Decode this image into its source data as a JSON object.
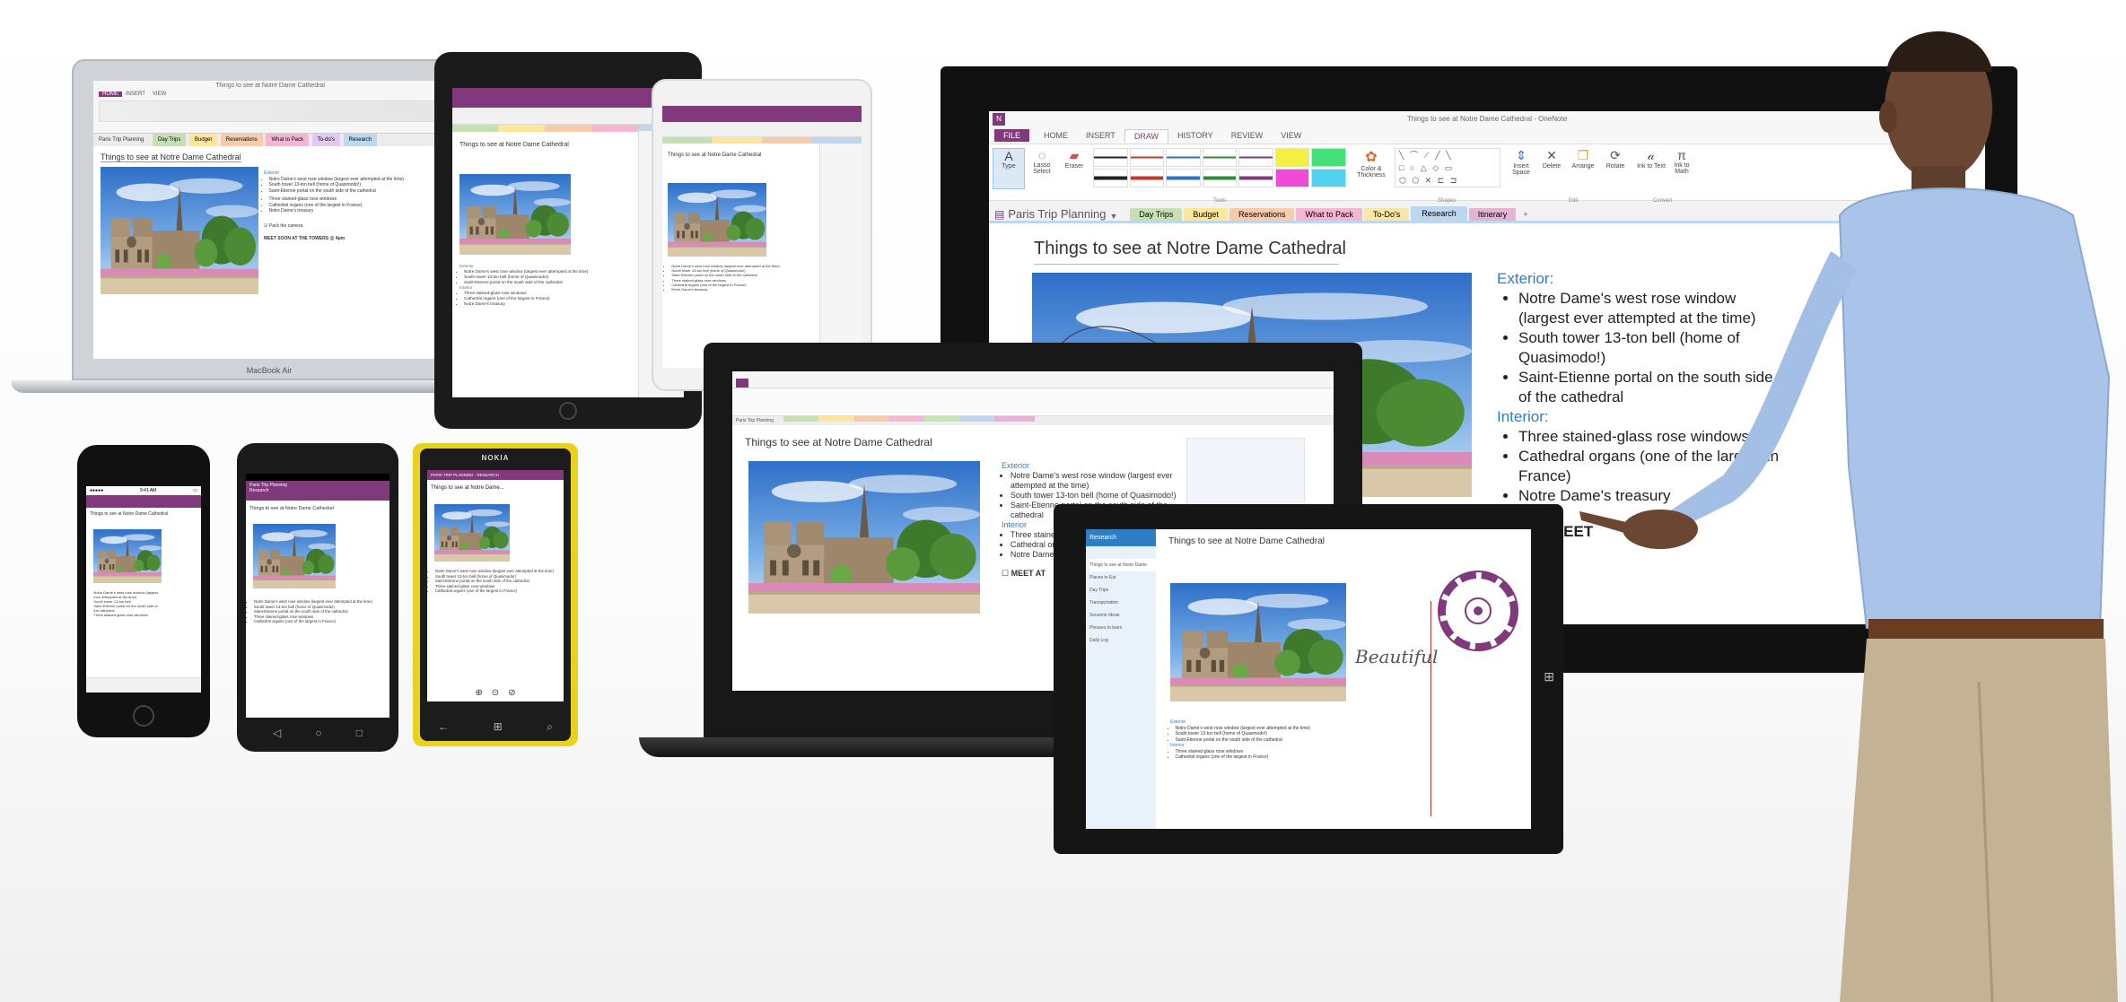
{
  "colors": {
    "onenote_purple": "#80397b",
    "header_blue": "#2e7ec6",
    "sky": "#3c83d4",
    "section_green": "#c6e0b4",
    "section_yellow": "#ffe699",
    "section_orange": "#f8cbad",
    "section_pink": "#f4b6d0",
    "section_blue": "#bdd7ee"
  },
  "tv": {
    "window_title": "Things to see at Notre Dame Cathedral - OneNote",
    "menu_tabs": [
      "FILE",
      "HOME",
      "INSERT",
      "DRAW",
      "HISTORY",
      "REVIEW",
      "VIEW"
    ],
    "tools": [
      "Type",
      "Lasso Select",
      "Eraser",
      "Color & Thickness",
      "Insert Space",
      "Delete",
      "Arrange",
      "Rotate",
      "Ink to Text",
      "Ink to Math"
    ],
    "group_labels": [
      "Tools",
      "Shapes",
      "Edit",
      "Convert"
    ],
    "notebook": "Paris Trip Planning",
    "sections": [
      "Day Trips",
      "Budget",
      "Reservations",
      "What to Pack",
      "To-Do's",
      "Research",
      "Itinerary"
    ],
    "add_section": "+",
    "page_title": "Things to see at Notre Dame Cathedral",
    "exterior_header": "Exterior:",
    "exterior_items": [
      "Notre Dame's west rose window (largest ever attempted at the time)",
      "South tower 13-ton bell (home of Quasimodo!)",
      "Saint-Etienne portal on the south side of the cathedral"
    ],
    "interior_header": "Interior:",
    "interior_items": [
      "Three stained-glass rose windows",
      "Cathedral organs (one of the largest in France)",
      "Notre Dame's treasury"
    ],
    "meet": "MEET"
  },
  "macbook": {
    "label": "MacBook Air",
    "window_title": "Things to see at Notre Dame Cathedral",
    "menu_tabs": [
      "HOME",
      "INSERT",
      "VIEW"
    ],
    "notebook": "Paris Trip Planning",
    "sections": [
      "Day Trips",
      "Budget",
      "Reservations",
      "What to Pack",
      "To-do's",
      "Research",
      "Itinerary"
    ],
    "page_title": "Things to see at Notre Dame Cathedral",
    "exterior_header": "Exterior",
    "exterior_items": [
      "Notre Dame's west rose window (largest ever attempted at the time)",
      "South tower 13-ton bell (home of Quasimodo!)",
      "Saint-Etienne portal on the south side of the cathedral"
    ],
    "interior_items": [
      "Three stained-glass rose windows",
      "Cathedral organs (one of the largest in France)",
      "Notre Dame's treasury"
    ],
    "pack": "Pack the camera",
    "meet": "MEET SOON AT THE TOWERS @ 4pm"
  },
  "ipad_black": {
    "page_title": "Things to see at Notre Dame Cathedral",
    "exterior_header": "Exterior",
    "exterior_items": [
      "Notre Dame's west rose window (largest ever attempted at the time)",
      "South tower 13-ton bell (home of Quasimodo!)",
      "Saint-Etienne portal on the south side of the cathedral"
    ],
    "interior_header": "Interior",
    "interior_items": [
      "Three stained-glass rose windows",
      "Cathedral organs (one of the largest in France)",
      "Notre Dame's treasury"
    ]
  },
  "ipad_white": {
    "page_title": "Things to see at Notre Dame Cathedral",
    "exterior_items": [
      "Notre Dame's west rose window (largest ever attempted at the time)",
      "South tower 13-ton bell (home of Quasimodo!)",
      "Saint-Etienne portal on the south side of the cathedral"
    ],
    "interior_items": [
      "Three stained-glass rose windows",
      "Cathedral organs (one of the largest in France)",
      "Notre Dame's treasury"
    ]
  },
  "iphone": {
    "carrier": "●●●●● ",
    "time": "9:41 AM",
    "page_title": "Things to see at Notre Dame Cathedral",
    "exterior_items": [
      "Notre Dame's west rose window (largest ever attempted at the time)",
      "South tower 13-ton bell",
      "Saint-Etienne portal on the south side of the cathedral"
    ],
    "interior_items": [
      "Three stained-glass rose windows"
    ]
  },
  "android": {
    "header": "Paris Trip Planning",
    "subheader": "Research",
    "page_title": "Things to see at Notre Dame Cathedral",
    "exterior_items": [
      "Notre Dame's west rose window (largest ever attempted at the time)",
      "South tower 13-ton bell (home of Quasimodo!)",
      "Saint-Etienne portal on the south side of the cathedral"
    ],
    "interior_items": [
      "Three stained-glass rose windows",
      "Cathedral organs (one of the largest in France)"
    ]
  },
  "nokia": {
    "brand": "NOKIA",
    "header": "PARIS TRIP PLANNING - RESEARCH",
    "page_title": "Things to see at Notre Dame...",
    "exterior_items": [
      "Notre Dame's west rose window (largest ever attempted at the time)",
      "South tower 13-ton bell (home of Quasimodo!)",
      "Saint-Etienne portal on the south side of the cathedral"
    ],
    "interior_items": [
      "Three stained-glass rose windows",
      "Cathedral organs (one of the largest in France)"
    ]
  },
  "laptop_center": {
    "notebook": "Paris Trip Planning",
    "page_title": "Things to see at Notre Dame Cathedral",
    "exterior_header": "Exterior",
    "exterior_items": [
      "Notre Dame's west rose window (largest ever attempted at the time)",
      "South tower 13-ton bell (home of Quasimodo!)",
      "Saint-Etienne portal on the south side of the cathedral"
    ],
    "interior_header": "Interior",
    "interior_items": [
      "Three stained-glass rose windows",
      "Cathedral organs (one of the largest in France)",
      "Notre Dame's treasury"
    ],
    "meet": "MEET AT"
  },
  "surface": {
    "section": "Research",
    "page_title": "Things to see at Notre Dame Cathedral",
    "pages": [
      "Things to see at Notre Dame",
      "Places to Eat",
      "Day Trips",
      "Transportation",
      "Souvenir Ideas",
      "Phrases to learn",
      "Daily Log"
    ],
    "handwriting": "Beautiful",
    "exterior_header": "Exterior",
    "exterior_items": [
      "Notre Dame's west rose window (largest ever attempted at the time)",
      "South tower 13-ton bell (home of Quasimodo!)",
      "Saint-Etienne portal on the south side of the cathedral"
    ],
    "interior_header": "Interior",
    "interior_items": [
      "Three stained-glass rose windows",
      "Cathedral organs (one of the largest in France)"
    ]
  }
}
